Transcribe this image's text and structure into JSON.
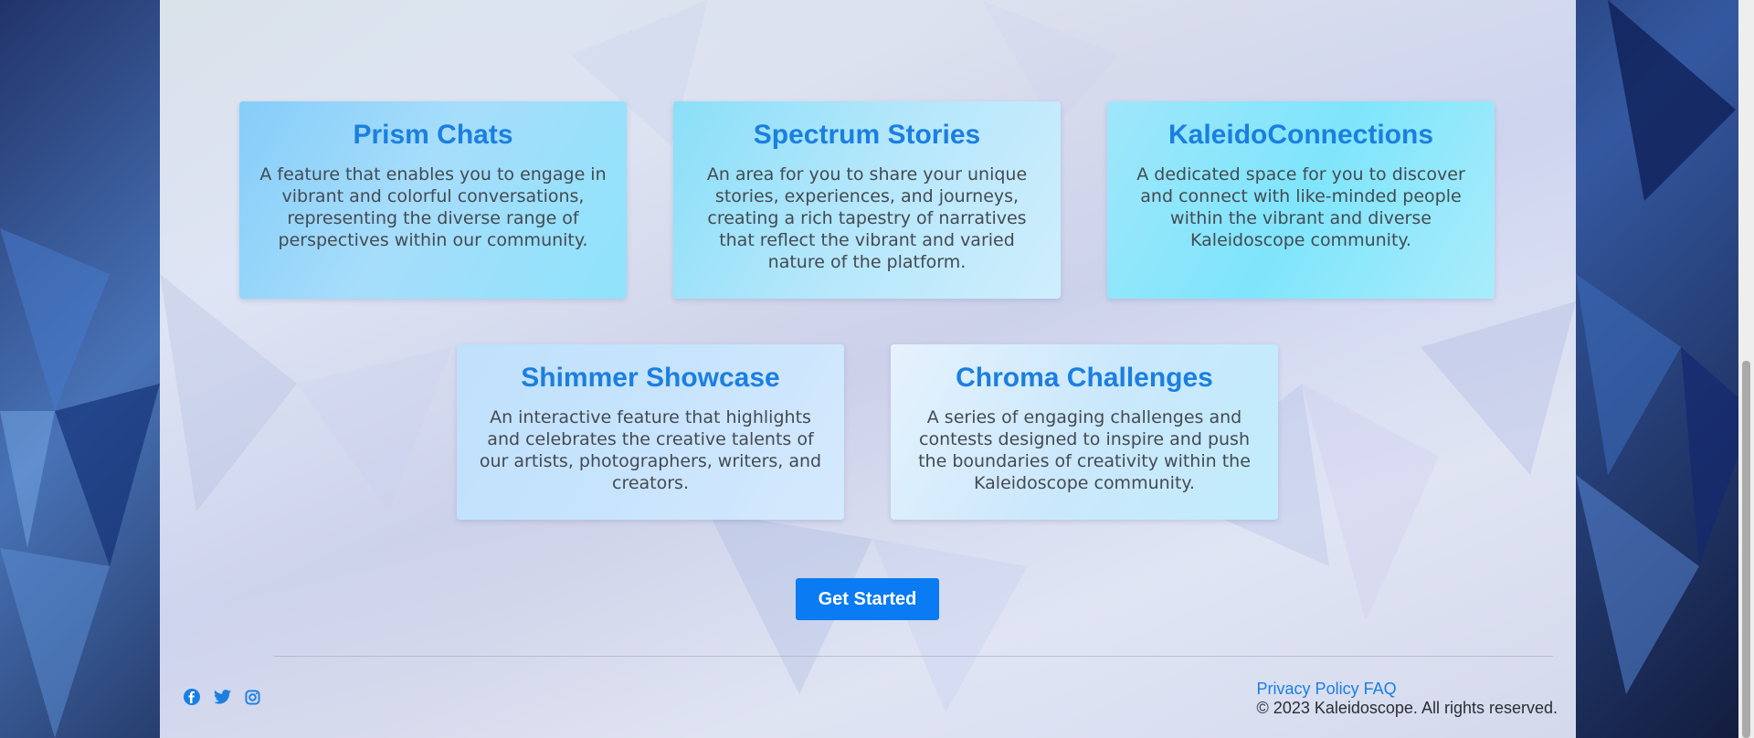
{
  "features": [
    {
      "title": "Prism Chats",
      "description": "A feature that enables you to engage in vibrant and colorful conversations, representing the diverse range of perspectives within our community."
    },
    {
      "title": "Spectrum Stories",
      "description": "An area for you to share your unique stories, experiences, and journeys, creating a rich tapestry of narratives that reflect the vibrant and varied nature of the platform."
    },
    {
      "title": "KaleidoConnections",
      "description": "A dedicated space for you to discover and connect with like-minded people within the vibrant and diverse Kaleidoscope community."
    },
    {
      "title": "Shimmer Showcase",
      "description": "An interactive feature that highlights and celebrates the creative talents of our artists, photographers, writers, and creators."
    },
    {
      "title": "Chroma Challenges",
      "description": "A series of engaging challenges and contests designed to inspire and push the boundaries of creativity within the Kaleidoscope community."
    }
  ],
  "cta": {
    "label": "Get Started"
  },
  "footer": {
    "links": [
      "Privacy Policy",
      "FAQ"
    ],
    "copyright": "© 2023 Kaleidoscope. All rights reserved.",
    "social": [
      "facebook-icon",
      "twitter-icon",
      "instagram-icon"
    ]
  },
  "colors": {
    "accent": "#0a7bf2",
    "title": "#1b7fe0",
    "text": "#444a52"
  }
}
